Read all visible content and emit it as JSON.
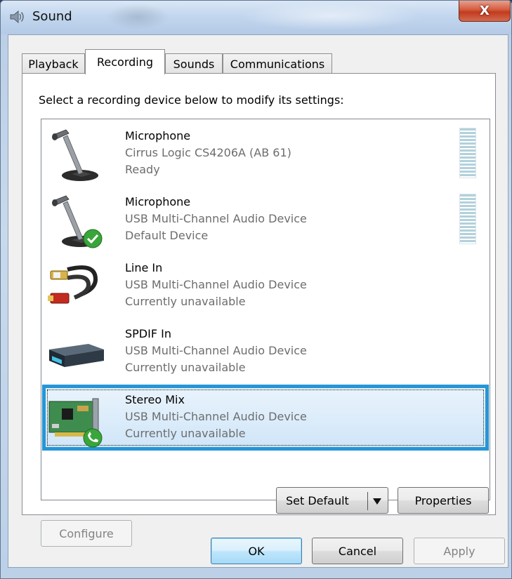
{
  "window": {
    "title": "Sound",
    "close_label": "X"
  },
  "tabs": [
    {
      "label": "Playback",
      "active": false
    },
    {
      "label": "Recording",
      "active": true
    },
    {
      "label": "Sounds",
      "active": false
    },
    {
      "label": "Communications",
      "active": false
    }
  ],
  "recording": {
    "instruction": "Select a recording device below to modify its settings:",
    "devices": [
      {
        "name": "Microphone",
        "driver": "Cirrus Logic CS4206A (AB 61)",
        "status": "Ready",
        "icon": "microphone-icon",
        "has_meter": true,
        "badge": ""
      },
      {
        "name": "Microphone",
        "driver": "USB Multi-Channel Audio Device",
        "status": "Default Device",
        "icon": "microphone-icon",
        "has_meter": true,
        "badge": "default-check-badge-icon"
      },
      {
        "name": "Line In",
        "driver": "USB Multi-Channel Audio Device",
        "status": "Currently unavailable",
        "icon": "rca-cable-icon",
        "has_meter": false,
        "badge": ""
      },
      {
        "name": "SPDIF In",
        "driver": "USB Multi-Channel Audio Device",
        "status": "Currently unavailable",
        "icon": "spdif-receiver-icon",
        "has_meter": false,
        "badge": ""
      },
      {
        "name": "Stereo Mix",
        "driver": "USB Multi-Channel Audio Device",
        "status": "Currently unavailable",
        "icon": "sound-card-icon",
        "has_meter": false,
        "badge": "communications-phone-badge-icon",
        "selected": true
      }
    ]
  },
  "panel_buttons": {
    "configure": "Configure",
    "set_default": "Set Default",
    "properties": "Properties"
  },
  "dialog_buttons": {
    "ok": "OK",
    "cancel": "Cancel",
    "apply": "Apply"
  },
  "colors": {
    "selection_border": "#2596d6",
    "meter_bar": "#b2d1dc",
    "close_button": "#c23b1e"
  }
}
